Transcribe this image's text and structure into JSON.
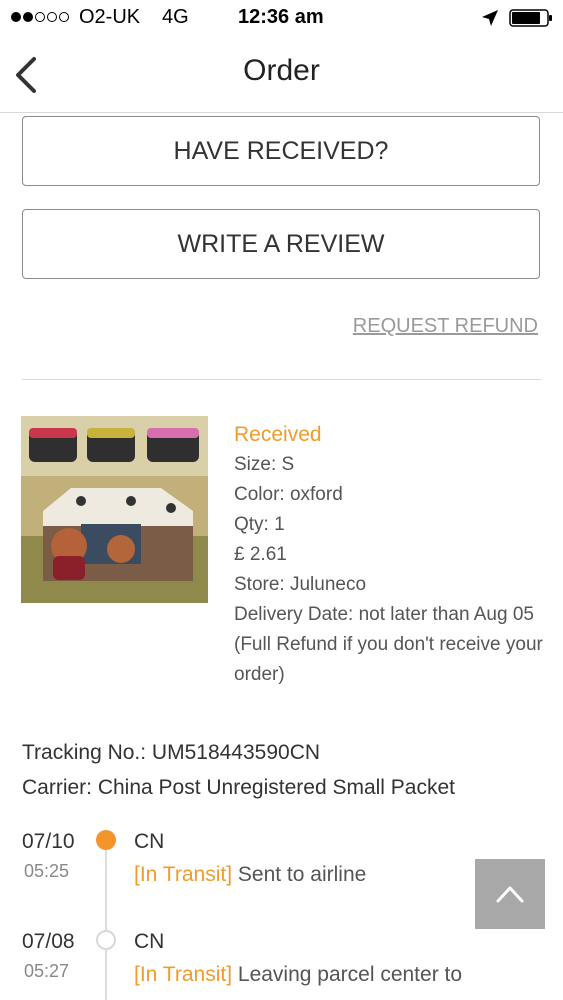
{
  "status_bar": {
    "carrier": "O2-UK",
    "network": "4G",
    "time": "12:36 am",
    "signal_strength": "2 of 5",
    "icons": [
      "location-arrow-icon",
      "battery-icon"
    ]
  },
  "nav": {
    "title": "Order",
    "back_icon": "chevron-left-icon"
  },
  "actions": {
    "have_received_label": "HAVE RECEIVED?",
    "write_review_label": "WRITE A REVIEW",
    "request_refund_label": "REQUEST REFUND"
  },
  "product": {
    "image_subject": "pet-playpen-tent-photo",
    "status": "Received",
    "size": "Size: S",
    "color": "Color: oxford",
    "qty": "Qty: 1",
    "price": "£ 2.61",
    "store": "Store: Juluneco",
    "delivery": "Delivery Date: not later than Aug 05 (Full Refund if you don't receive your order)"
  },
  "tracking": {
    "tracking_no": "Tracking No.: UM518443590CN",
    "carrier": "Carrier: China Post Unregistered Small Packet"
  },
  "timeline": [
    {
      "date": "07/10",
      "time": "05:25",
      "country": "CN",
      "tag": "[In Transit]",
      "desc": "Sent to airline",
      "active": true
    },
    {
      "date": "07/08",
      "time": "05:27",
      "country": "CN",
      "tag": "[In Transit]",
      "desc": "Leaving parcel center to",
      "active": false
    }
  ],
  "colors": {
    "accent": "#ef9b2d",
    "active_node": "#f4952b",
    "scroll_button": "#a8a8a8"
  },
  "scroll_top_icon": "chevron-up-icon"
}
